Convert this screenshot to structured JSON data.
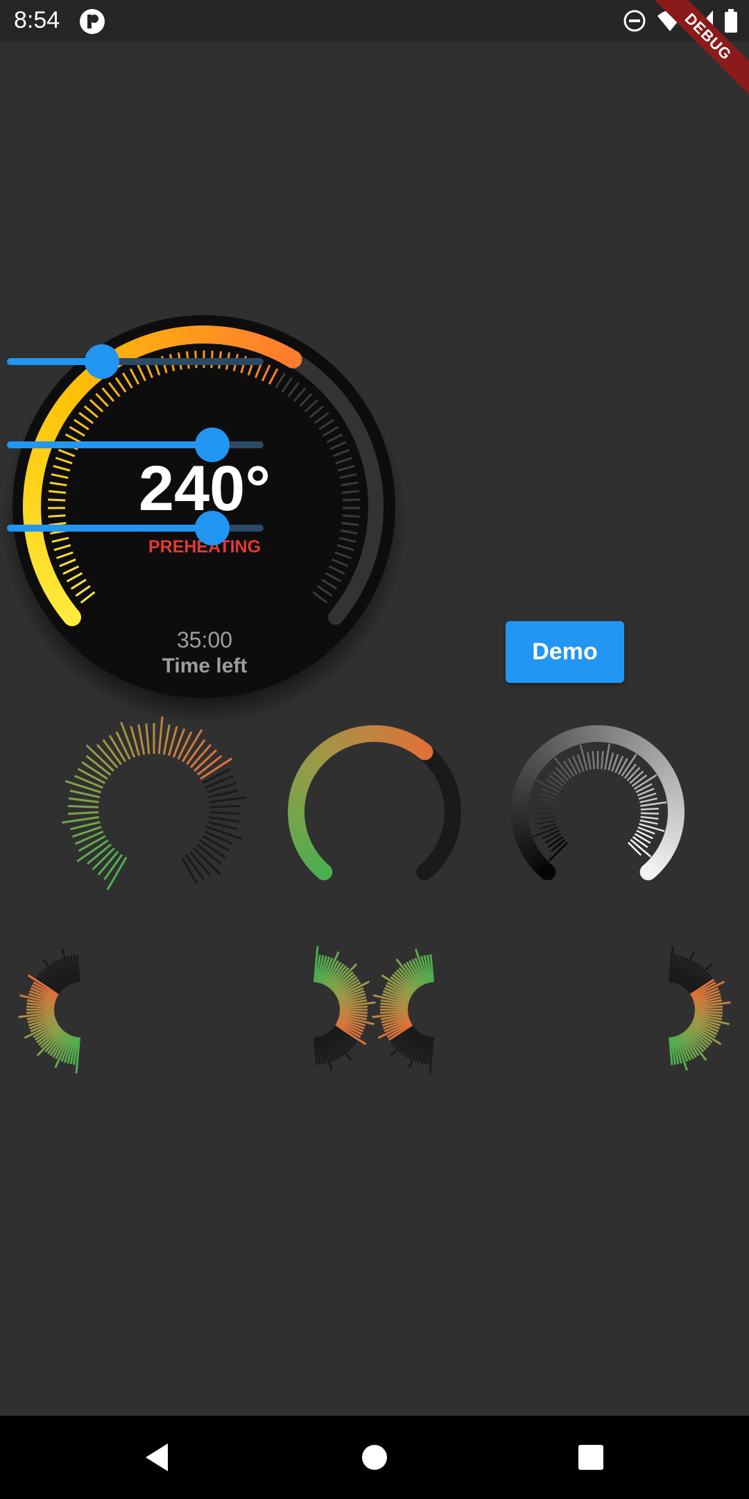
{
  "status_bar": {
    "time": "8:54",
    "icons": [
      "app-notification-icon",
      "do-not-disturb-icon",
      "wifi-icon",
      "cellular-signal-icon",
      "battery-icon"
    ]
  },
  "debug_banner": {
    "label": "DEBUG"
  },
  "main_gauge": {
    "temperature": "240°",
    "status": "PREHEATING",
    "time_remaining": "35:00",
    "time_caption": "Time left",
    "progress_fraction": 0.62,
    "colors": {
      "start": "#ffeb3b",
      "middle": "#ffc107",
      "end": "#ff7b2e",
      "inactive": "#333333",
      "face": "#0d0d0d"
    }
  },
  "sliders": [
    {
      "name": "slider-1",
      "value_fraction": 0.37
    },
    {
      "name": "slider-2",
      "value_fraction": 0.8
    },
    {
      "name": "slider-3",
      "value_fraction": 0.8
    }
  ],
  "demo_button": {
    "label": "Demo"
  },
  "accent_color": "#2196f3",
  "preview_gauges": {
    "colors": {
      "green": "#4caf50",
      "olive": "#9a9a48",
      "orange": "#e0703a",
      "dark": "#1a1a1a",
      "white": "#f2f2f2"
    }
  },
  "nav_bar": {
    "buttons": [
      "back-icon",
      "home-icon",
      "recents-icon"
    ]
  }
}
